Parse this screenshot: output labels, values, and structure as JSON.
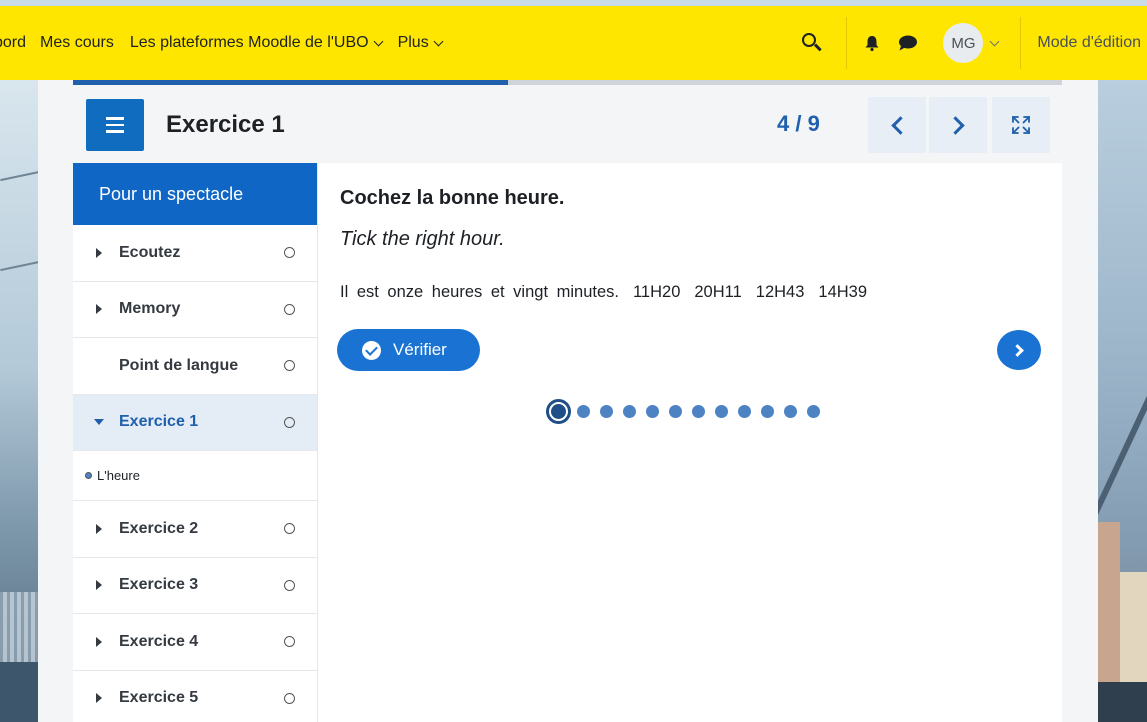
{
  "navbar": {
    "items": [
      {
        "label": "bord",
        "dropdown": false
      },
      {
        "label": "Mes cours",
        "dropdown": false
      },
      {
        "label": "Les plateformes Moodle de l'UBO",
        "dropdown": true
      },
      {
        "label": "Plus",
        "dropdown": true
      }
    ],
    "avatar_initials": "MG",
    "edit_mode_label": "Mode d'édition",
    "background_color": "#ffe600"
  },
  "activity": {
    "title": "Exercice 1",
    "counter": "4 / 9",
    "progress_fraction": 0.44
  },
  "sidebar": {
    "heading": "Pour un spectacle",
    "items": [
      {
        "label": "Ecoutez",
        "expandable": true,
        "expanded": false,
        "active": false
      },
      {
        "label": "Memory",
        "expandable": true,
        "expanded": false,
        "active": false
      },
      {
        "label": "Point de langue",
        "expandable": false,
        "expanded": false,
        "active": false
      },
      {
        "label": "Exercice 1",
        "expandable": true,
        "expanded": true,
        "active": true
      },
      {
        "label": "L'heure",
        "subitem": true
      },
      {
        "label": "Exercice 2",
        "expandable": true,
        "expanded": false,
        "active": false
      },
      {
        "label": "Exercice 3",
        "expandable": true,
        "expanded": false,
        "active": false
      },
      {
        "label": "Exercice 4",
        "expandable": true,
        "expanded": false,
        "active": false
      },
      {
        "label": "Exercice 5",
        "expandable": true,
        "expanded": false,
        "active": false
      }
    ]
  },
  "question": {
    "title": "Cochez la bonne heure.",
    "subtitle": "Tick the right hour.",
    "sentence": "Il est onze heures et vingt minutes.",
    "options": [
      "11H20",
      "20H11",
      "12H43",
      "14H39"
    ],
    "verify_label": "Vérifier",
    "pager": {
      "total": 12,
      "current": 1
    }
  },
  "colors": {
    "primary": "#0f6cbf",
    "accent_blue": "#1f5fab",
    "button_blue": "#1a73d3"
  }
}
